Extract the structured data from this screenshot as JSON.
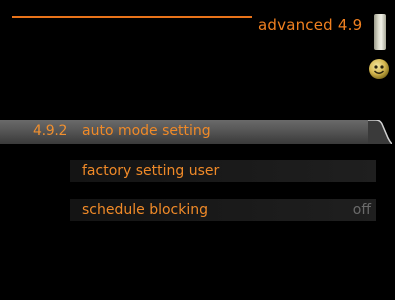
{
  "header": {
    "title": "advanced 4.9",
    "accent_color": "#e8731a"
  },
  "icons": {
    "scroll": "scroll-bar-icon",
    "status": "smiley-status-icon"
  },
  "menu": {
    "items": [
      {
        "number": "4.9.2",
        "label": "auto mode setting",
        "selected": true
      },
      {
        "label": "factory setting user"
      },
      {
        "label": "schedule blocking",
        "value": "off"
      }
    ]
  }
}
